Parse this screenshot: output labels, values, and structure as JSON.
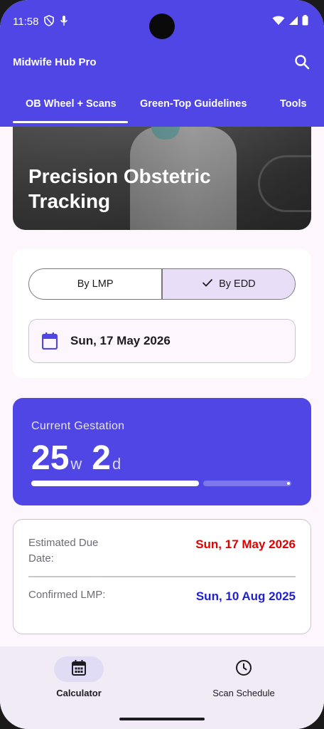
{
  "status": {
    "time": "11:58"
  },
  "app": {
    "title": "Midwife Hub Pro"
  },
  "tabs": [
    {
      "label": "OB Wheel + Scans",
      "selected": true
    },
    {
      "label": "Green-Top Guidelines",
      "selected": false
    },
    {
      "label": "Tools",
      "selected": false
    }
  ],
  "hero": {
    "title": "Precision Obstetric Tracking"
  },
  "mode_toggle": {
    "options": [
      {
        "label": "By LMP",
        "selected": false
      },
      {
        "label": "By EDD",
        "selected": true
      }
    ]
  },
  "date_input": {
    "value": "Sun, 17 May 2026",
    "icon": "calendar-icon"
  },
  "gestation": {
    "label": "Current Gestation",
    "weeks": "25",
    "weeks_unit": "w",
    "days": "2",
    "days_unit": "d",
    "progress": 0.645
  },
  "results": {
    "edd": {
      "label": "Estimated Due Date:",
      "value": "Sun, 17 May 2026",
      "color": "#e00000"
    },
    "lmp": {
      "label": "Confirmed LMP:",
      "value": "Sun, 10 Aug 2025",
      "color": "#1f1fd6"
    }
  },
  "bottom_nav": [
    {
      "label": "Calculator",
      "icon": "calendar-grid-icon",
      "active": true
    },
    {
      "label": "Scan Schedule",
      "icon": "clock-icon",
      "active": false
    }
  ],
  "colors": {
    "primary": "#4f46e5",
    "background": "#fdf7fd",
    "segment_selected": "#e8def8"
  }
}
